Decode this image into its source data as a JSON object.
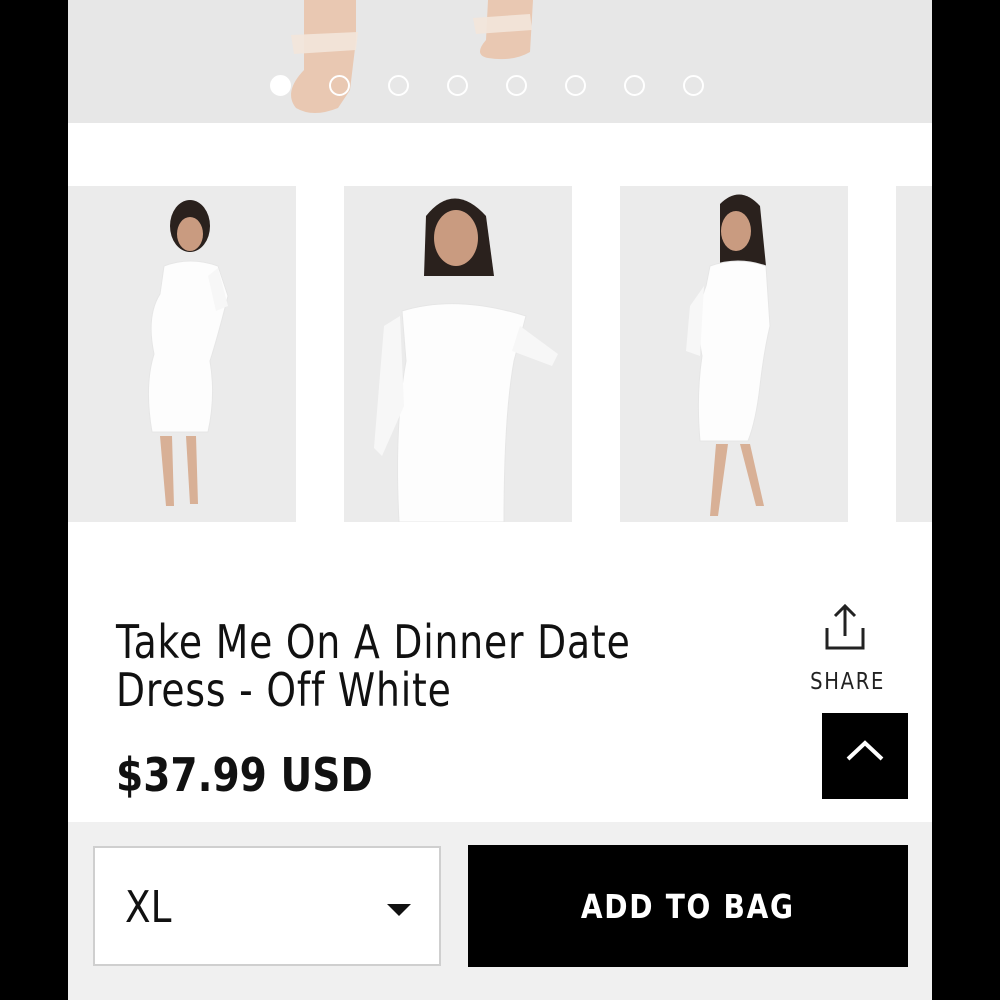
{
  "gallery": {
    "slide_count": 8,
    "active_slide": 1
  },
  "product": {
    "title": "Take Me On A Dinner Date Dress - Off White",
    "price": "$37.99 USD"
  },
  "actions": {
    "share_label": "SHARE",
    "size_value": "XL",
    "add_to_bag_label": "ADD TO BAG"
  },
  "icons": {
    "share": "share-icon",
    "scroll_top": "chevron-up-icon",
    "size_caret": "caret-down-icon"
  },
  "colors": {
    "button": "#000000",
    "page_bg": "#ffffff",
    "image_bg": "#e7e7e7"
  }
}
